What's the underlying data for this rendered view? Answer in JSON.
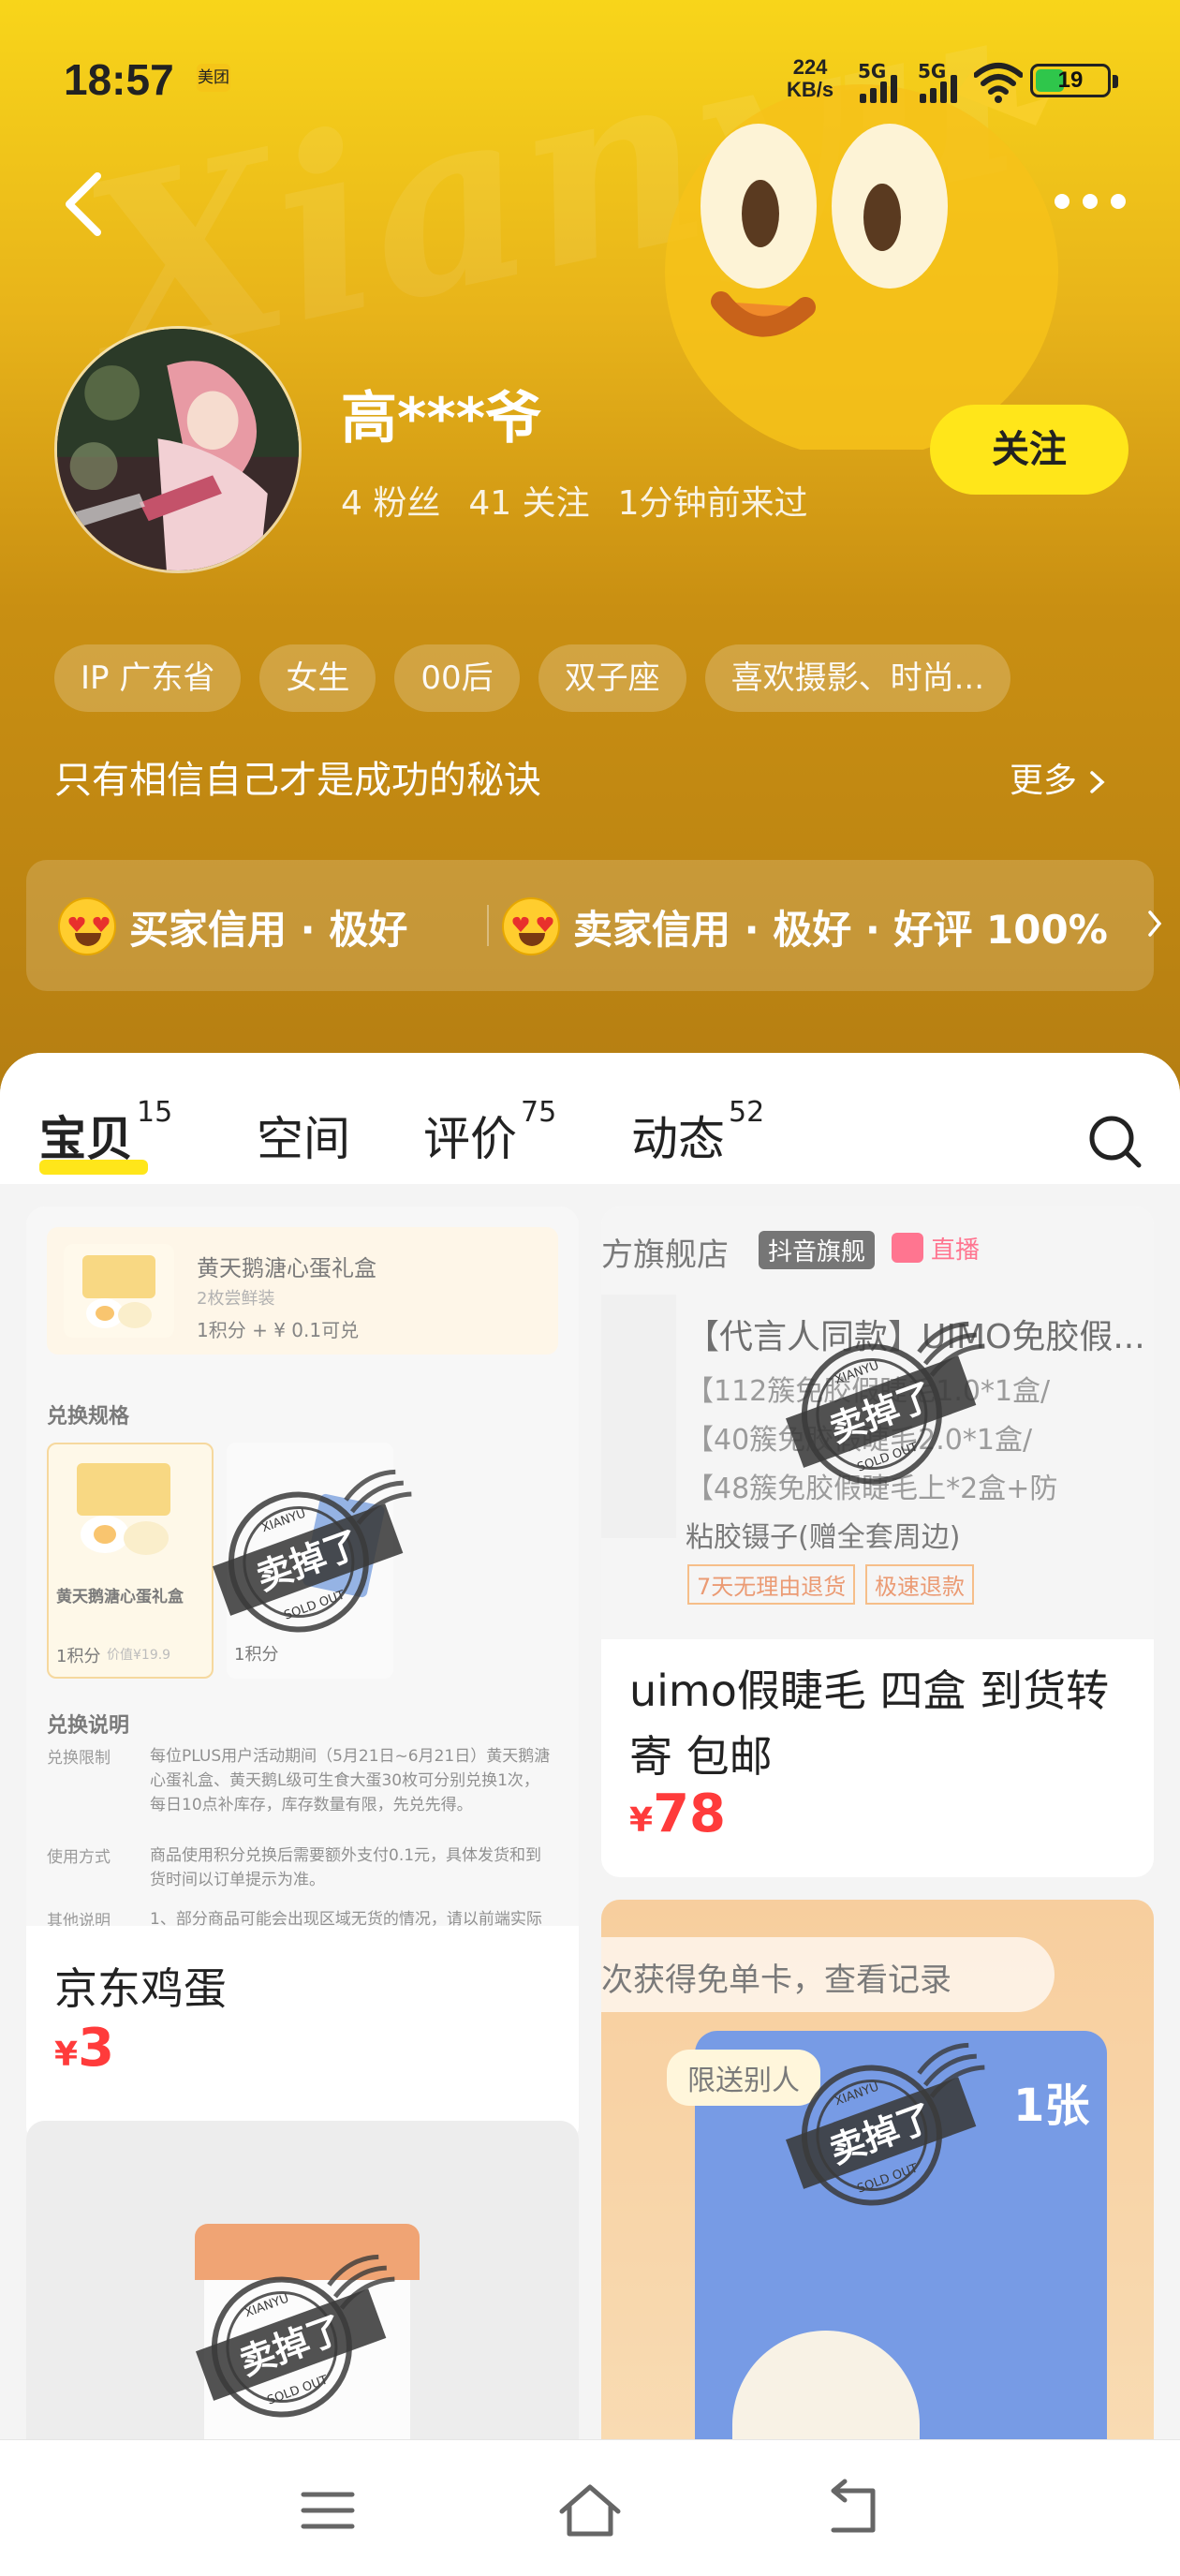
{
  "status_bar": {
    "time": "18:57",
    "app_badge": "美团",
    "net_speed_value": "224",
    "net_speed_unit": "KB/s",
    "sig1": "5G",
    "sig2": "5G",
    "battery": "19"
  },
  "watermark": "Xianyu",
  "profile": {
    "username": "高***爷",
    "fans": "4 粉丝",
    "following": "41 关注",
    "last_seen": "1分钟前来过",
    "follow_label": "关注",
    "tags": [
      "IP 广东省",
      "女生",
      "00后",
      "双子座",
      "喜欢摄影、时尚..."
    ],
    "bio": "只有相信自己才是成功的秘诀",
    "bio_more": "更多"
  },
  "credit": {
    "buyer": "买家信用 · 极好",
    "seller": "卖家信用 · 极好 · 好评 100%"
  },
  "tabs": [
    {
      "label": "宝贝",
      "count": "15"
    },
    {
      "label": "空间",
      "count": ""
    },
    {
      "label": "评价",
      "count": "75"
    },
    {
      "label": "动态",
      "count": "52"
    }
  ],
  "items": [
    {
      "title": "京东鸡蛋",
      "currency": "¥",
      "price": "3",
      "image": {
        "product_name": "黄天鹅溏心蛋礼盒",
        "product_sub": "2枚尝鲜装",
        "product_points": "1积分 + ¥ 0.1可兑",
        "spec_label": "兑换规格",
        "spec_item": "黄天鹅溏心蛋礼盒",
        "spec_points": "1积分",
        "spec_price": "价值¥19.9",
        "spec_points2": "1积分",
        "desc_title": "兑换说明",
        "desc_rows": [
          {
            "key": "兑换限制",
            "val": "每位PLUS用户活动期间（5月21日~6月21日）黄天鹅溏心蛋礼盒、黄天鹅L级可生食大蛋30枚可分别兑换1次，每日10点补库存，库存数量有限，先兑先得。"
          },
          {
            "key": "使用方式",
            "val": "商品使用积分兑换后需要额外支付0.1元，具体发货和到货时间以订单提示为准。"
          },
          {
            "key": "其他说明",
            "val": "1、部分商品可能会出现区域无货的情况，请以前端实际"
          }
        ]
      }
    },
    {
      "title": "uimo假睫毛 四盒 到货转寄 包邮",
      "currency": "¥",
      "price": "78",
      "image": {
        "store": "方旗舰店",
        "badge": "抖音旗舰",
        "live": "直播",
        "product": "【代言人同款】UIMO免胶假...",
        "lines": [
          "【112簇免胶假睫毛1.0*1盒/",
          "【40簇免胶假睫毛2.0*1盒/",
          "【48簇免胶假睫毛上*2盒+防",
          "粘胶镊子(赠全套周边)"
        ],
        "policy1": "7天无理由退货",
        "policy2": "极速退款"
      }
    },
    {
      "image": {
        "banner": "次获得免单卡，查看记录",
        "ticket_label": "限送别人",
        "ticket_count": "1张"
      }
    },
    {
      "image": {}
    }
  ],
  "stamp": {
    "text": "卖掉了",
    "brand": "XIANYU",
    "sold": "SOLD OUT"
  }
}
